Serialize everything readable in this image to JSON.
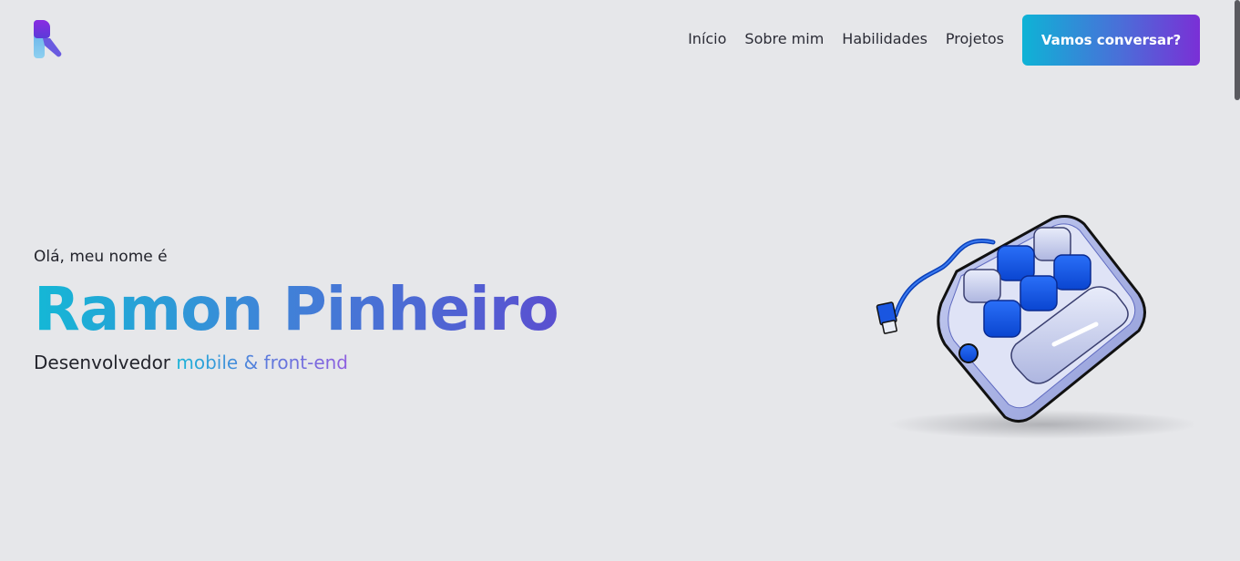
{
  "header": {
    "logo_icon": "r-logo-icon",
    "nav": [
      {
        "label": "Início"
      },
      {
        "label": "Sobre mim"
      },
      {
        "label": "Habilidades"
      },
      {
        "label": "Projetos"
      }
    ],
    "cta_label": "Vamos conversar?"
  },
  "hero": {
    "greeting": "Olá, meu nome é",
    "name": "Ramon Pinheiro",
    "role_prefix": "Desenvolvedor",
    "role_highlight": "mobile & front-end"
  },
  "illustration": {
    "icon": "macro-keypad-icon"
  },
  "colors": {
    "background": "#e6e7ea",
    "gradient_start": "#0eb3d6",
    "gradient_end": "#7a2fd6",
    "key_blue": "#0a5df0"
  }
}
